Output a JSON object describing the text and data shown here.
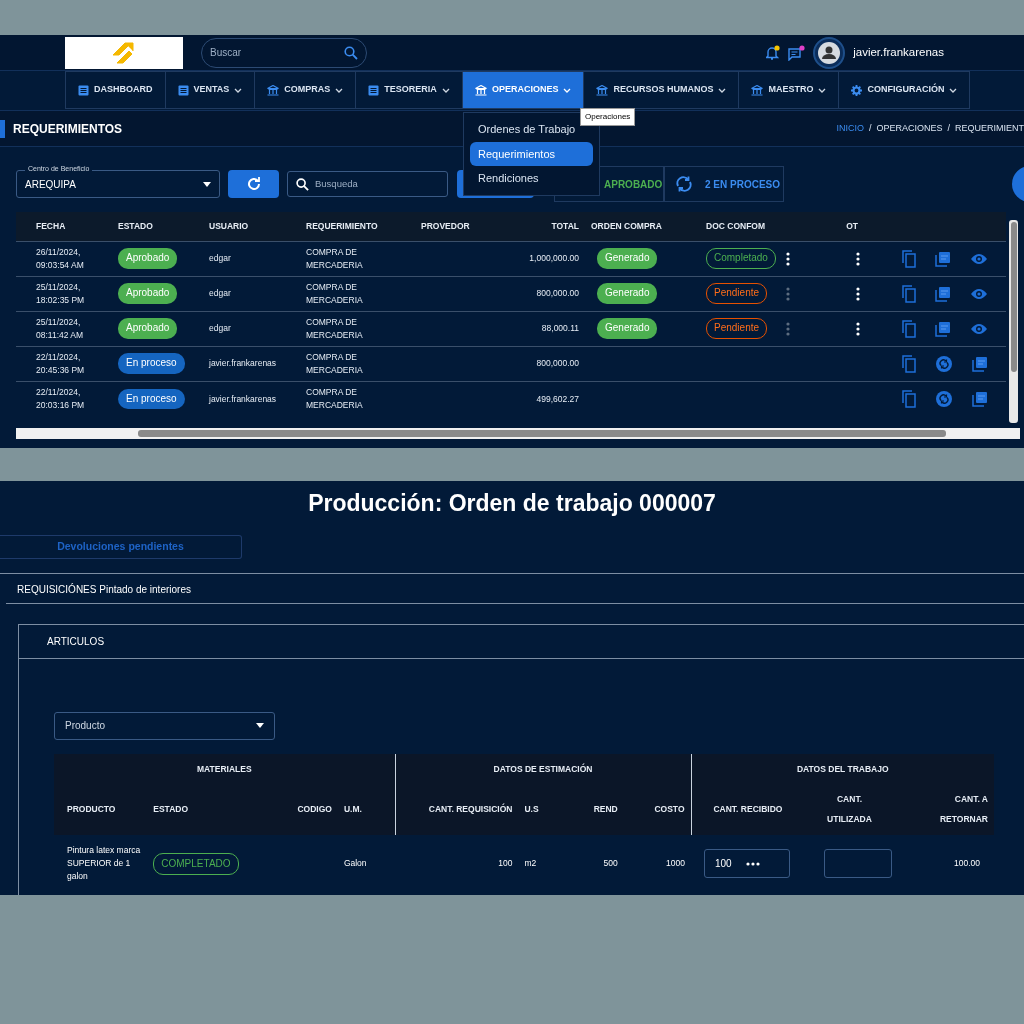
{
  "top": {
    "search": {
      "placeholder": "Buscar"
    },
    "user": {
      "name": "javier.frankarenas"
    },
    "nav": [
      {
        "label": "DASHBOARD",
        "kind": "list",
        "has_caret": false,
        "selected": false
      },
      {
        "label": "VENTAS",
        "kind": "list",
        "has_caret": true,
        "selected": false
      },
      {
        "label": "COMPRAS",
        "kind": "bank",
        "has_caret": true,
        "selected": false
      },
      {
        "label": "TESORERIA",
        "kind": "list",
        "has_caret": true,
        "selected": false
      },
      {
        "label": "OPERACIONES",
        "kind": "bank",
        "has_caret": true,
        "selected": true
      },
      {
        "label": "RECURSOS HUMANOS",
        "kind": "bank",
        "has_caret": true,
        "selected": false
      },
      {
        "label": "MAESTRO",
        "kind": "bank",
        "has_caret": true,
        "selected": false
      },
      {
        "label": "CONFIGURACIÓN",
        "kind": "gear",
        "has_caret": true,
        "selected": false
      }
    ],
    "dropdown_menu": [
      {
        "label": "Ordenes de Trabajo",
        "selected": false
      },
      {
        "label": "Requerimientos",
        "selected": true
      },
      {
        "label": "Rendiciones",
        "selected": false
      }
    ],
    "tooltip": "Operaciones",
    "page_title": "REQUERIMIENTOS",
    "breadcrumb": [
      {
        "label": "INICIO",
        "kind": "link"
      },
      {
        "label": "/",
        "kind": "separator"
      },
      {
        "label": "OPERACIONES",
        "kind": "current"
      },
      {
        "label": "/",
        "kind": "separator"
      },
      {
        "label": "REQUERIMIENT",
        "kind": "current"
      }
    ],
    "filter": {
      "label": "Centro de Beneficio",
      "value": "AREQUIPA"
    },
    "search_field": {
      "placeholder": "Busqueda"
    },
    "status_counts": [
      {
        "label": "APROBADO",
        "kind": "approved"
      },
      {
        "label": "2 EN PROCESO",
        "kind": "in_progress"
      }
    ],
    "table": {
      "columns": [
        "FECHA",
        "ESTADO",
        "USUARIO",
        "REQUERIMIENTO",
        "PROVEDOR",
        "TOTAL",
        "ORDEN COMPRA",
        "DOC CONFOM",
        "OT"
      ],
      "rows": [
        {
          "fecha": "26/11/2024, 09:03:54 AM",
          "estado": {
            "label": "Aprobado",
            "kind": "approved"
          },
          "usuario": "edgar",
          "requerimiento": "COMPRA DE MERCADERIA",
          "total": "1,000,000.00",
          "orden_compra": "Generado",
          "doc_confom": {
            "label": "Completado",
            "kind": "completed"
          },
          "doc_menu": {
            "disabled": false
          },
          "ot_menu": true,
          "actions": [
            {
              "kind": "copy"
            },
            {
              "kind": "pdf"
            },
            {
              "kind": "view"
            }
          ]
        },
        {
          "fecha": "25/11/2024, 18:02:35 PM",
          "estado": {
            "label": "Aprobado",
            "kind": "approved"
          },
          "usuario": "edgar",
          "requerimiento": "COMPRA DE MERCADERIA",
          "total": "800,000.00",
          "orden_compra": "Generado",
          "doc_confom": {
            "label": "Pendiente",
            "kind": "pending"
          },
          "doc_menu": {
            "disabled": true
          },
          "ot_menu": true,
          "actions": [
            {
              "kind": "copy"
            },
            {
              "kind": "pdf"
            },
            {
              "kind": "view"
            }
          ]
        },
        {
          "fecha": "25/11/2024, 08:11:42 AM",
          "estado": {
            "label": "Aprobado",
            "kind": "approved"
          },
          "usuario": "edgar",
          "requerimiento": "COMPRA DE MERCADERIA",
          "total": "88,000.11",
          "orden_compra": "Generado",
          "doc_confom": {
            "label": "Pendiente",
            "kind": "pending"
          },
          "doc_menu": {
            "disabled": true
          },
          "ot_menu": true,
          "actions": [
            {
              "kind": "copy"
            },
            {
              "kind": "pdf"
            },
            {
              "kind": "view"
            }
          ]
        },
        {
          "fecha": "22/11/2024, 20:45:36 PM",
          "estado": {
            "label": "En proceso",
            "kind": "in_progress"
          },
          "usuario": "javier.frankarenas",
          "requerimiento": "COMPRA DE MERCADERIA",
          "total": "800,000.00",
          "ot_menu": false,
          "actions": [
            {
              "kind": "copy"
            },
            {
              "kind": "sync"
            },
            {
              "kind": "pdf"
            }
          ]
        },
        {
          "fecha": "22/11/2024, 20:03:16 PM",
          "estado": {
            "label": "En proceso",
            "kind": "in_progress"
          },
          "usuario": "javier.frankarenas",
          "requerimiento": "COMPRA DE MERCADERIA",
          "total": "499,602.27",
          "ot_menu": false,
          "actions": [
            {
              "kind": "copy"
            },
            {
              "kind": "sync"
            },
            {
              "kind": "pdf"
            }
          ]
        }
      ]
    }
  },
  "bottom": {
    "title": "Producción: Orden de trabajo 000007",
    "tab_button": "Devoluciones pendientes",
    "requisition": "REQUISICIÓNES Pintado de interiores",
    "card_title": "ARTICULOS",
    "product_select": {
      "placeholder": "Producto"
    },
    "table": {
      "groups": [
        {
          "label": "MATERIALES",
          "columns": [
            "PRODUCTO",
            "ESTADO",
            "CODIGO",
            "U.M."
          ]
        },
        {
          "label": "DATOS DE ESTIMACIÓN",
          "columns": [
            "CANT. REQUISICIÓN",
            "U.S",
            "REND",
            "COSTO"
          ]
        },
        {
          "label": "DATOS DEL TRABAJO",
          "columns": [
            "CANT. RECIBIDO",
            "CANT. UTILIZADA",
            "CANT. A RETORNAR"
          ]
        }
      ],
      "rows": [
        {
          "producto": "Pintura latex marca SUPERIOR de 1 galon",
          "estado": "COMPLETADO",
          "um": "Galon",
          "cant_requisicion": "100",
          "us": "m2",
          "rend": "500",
          "costo": "1000",
          "cant_recibido": "100",
          "cant_retornar": "100.00"
        }
      ]
    }
  }
}
